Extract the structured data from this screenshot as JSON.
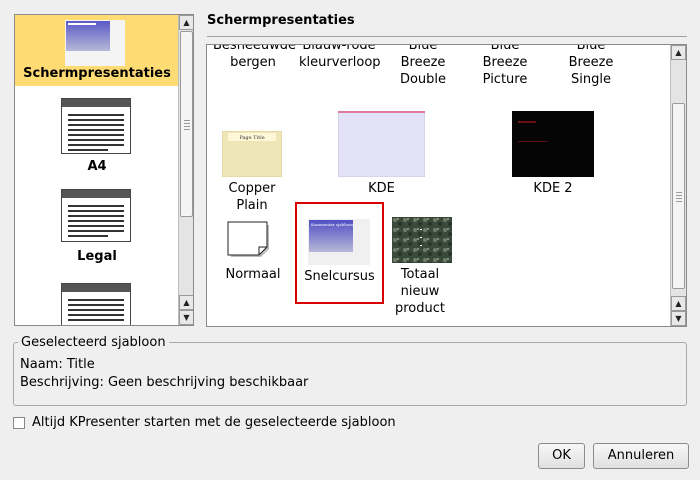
{
  "categories": [
    {
      "label": "Schermpresentaties",
      "selected": true
    },
    {
      "label": "A4",
      "selected": false
    },
    {
      "label": "Legal",
      "selected": false
    },
    {
      "label": "",
      "selected": false
    }
  ],
  "templates": {
    "title": "Schermpresentaties",
    "items": [
      {
        "label": "Besneeuwde bergen"
      },
      {
        "label": "Blauw-rode kleurverloop"
      },
      {
        "label": "Blue Breeze Double"
      },
      {
        "label": "Blue Breeze Picture"
      },
      {
        "label": "Blue Breeze Single"
      },
      {
        "label": "Copper Plain",
        "thumb_text": "Page Title"
      },
      {
        "label": "KDE"
      },
      {
        "label": "KDE 2"
      },
      {
        "label": "Normaal"
      },
      {
        "label": "Snelcursus",
        "selected": true,
        "thumb_text": "Kommentar sjabloon"
      },
      {
        "label": "Totaal nieuw product"
      }
    ]
  },
  "selected_template": {
    "group_title": "Geselecteerd sjabloon",
    "name_line": "Naam: Title",
    "description_line": "Beschrijving: Geen beschrijving beschikbaar"
  },
  "startup_option": {
    "label": "Altijd KPresenter starten met de geselecteerde sjabloon",
    "checked": false
  },
  "buttons": {
    "ok": "OK",
    "cancel": "Annuleren"
  },
  "colors": {
    "selection_bg": "#ffdb73",
    "selected_border": "#d90000"
  }
}
